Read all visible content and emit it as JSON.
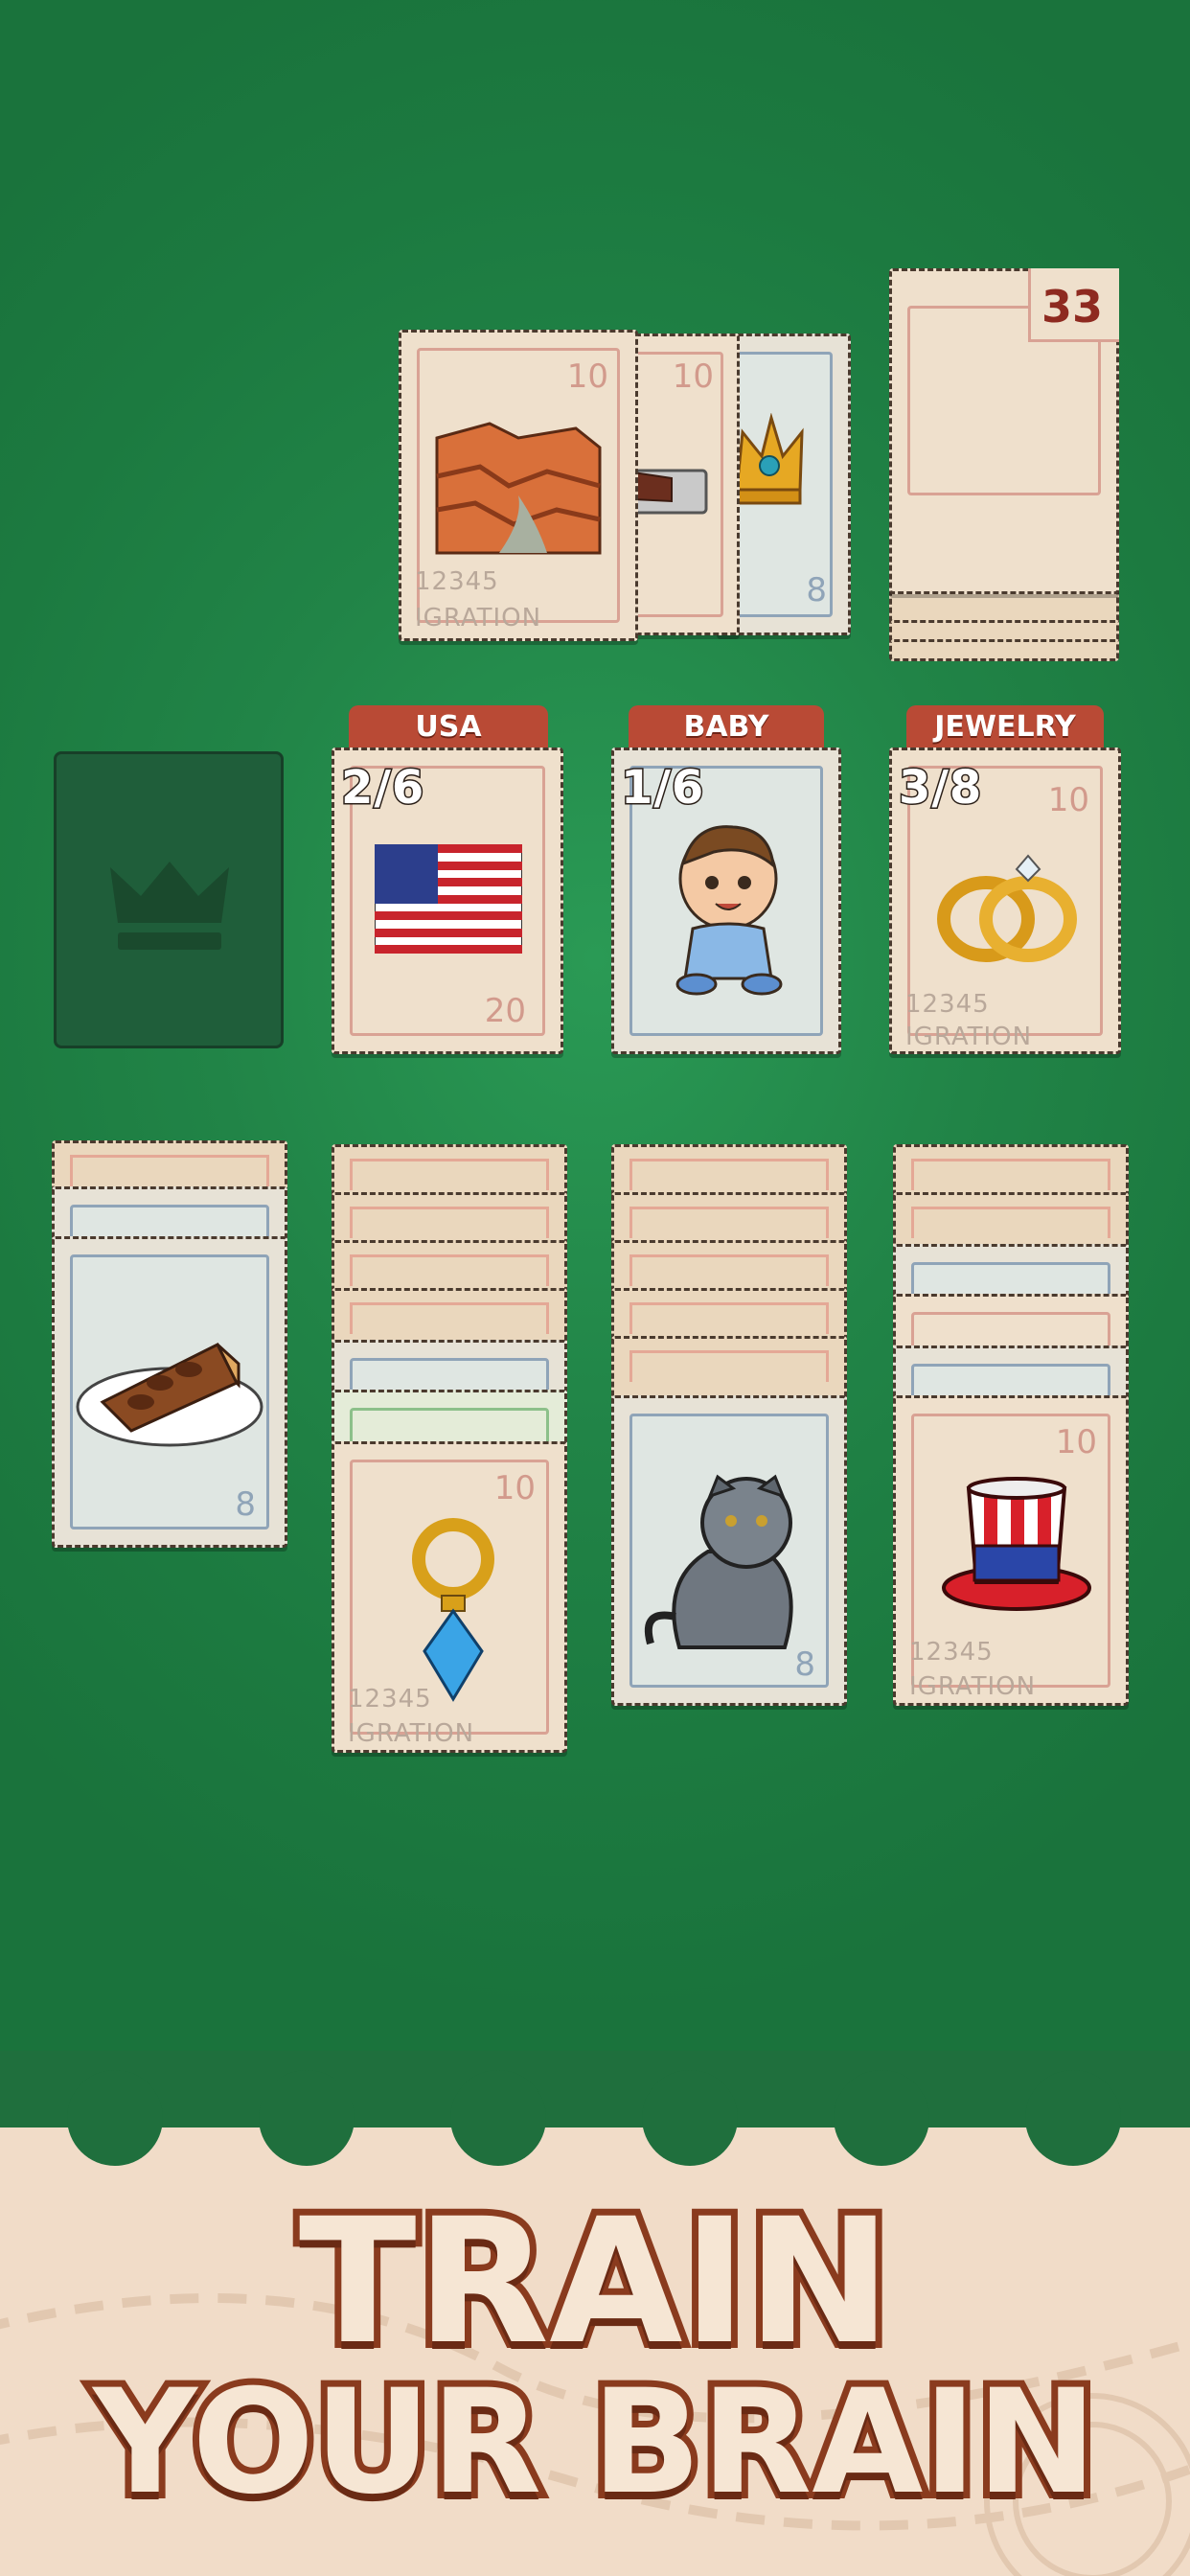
{
  "stock": {
    "count": "33"
  },
  "waste": {
    "cards": [
      {
        "value": "10",
        "image": "grand-canyon"
      },
      {
        "value": "10",
        "image": "steak-tray"
      },
      {
        "value": "8",
        "image": "crown"
      }
    ],
    "postmark": "12345",
    "postmark_text": "IGRATION"
  },
  "foundation_empty": {
    "icon": "crown-icon"
  },
  "categories": [
    {
      "label": "USA",
      "count": "2/6",
      "value": "20",
      "image": "usa-flag"
    },
    {
      "label": "BABY",
      "count": "1/6",
      "value": "",
      "image": "baby"
    },
    {
      "label": "JEWELRY",
      "count": "3/8",
      "value": "10",
      "image": "wedding-rings",
      "postmark": "12345",
      "postmark_text": "IGRATION"
    }
  ],
  "tableau": [
    {
      "top_value": "8",
      "image": "pecan-pie"
    },
    {
      "top_value": "10",
      "image": "pendant",
      "postmark": "12345",
      "postmark_text": "IGRATION"
    },
    {
      "top_value": "8",
      "image": "cat"
    },
    {
      "top_value": "10",
      "image": "uncle-sam-hat",
      "postmark": "12345",
      "postmark_text": "IGRATION"
    }
  ],
  "banner": {
    "line1": "TRAIN",
    "line2": "YOUR BRAIN"
  },
  "colors": {
    "felt": "#218447",
    "tab": "#b94a35",
    "stamp": "#efe0cc"
  }
}
